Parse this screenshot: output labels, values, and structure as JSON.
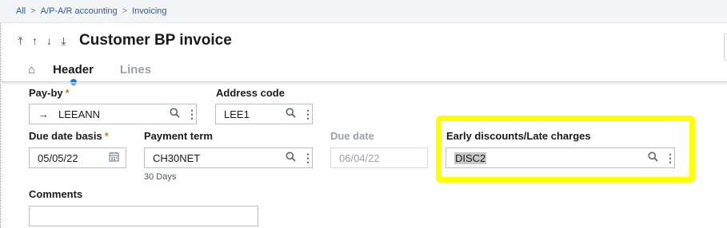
{
  "breadcrumb": {
    "items": [
      "All",
      "A/P-A/R accounting",
      "Invoicing"
    ],
    "separator": ">"
  },
  "title": "Customer BP invoice",
  "nav_icons": {
    "first": "⤒",
    "prev": "↑",
    "next": "↓",
    "last": "⤓"
  },
  "tabs": {
    "home_icon": "⌂",
    "header": "Header",
    "lines": "Lines"
  },
  "fields": {
    "pay_by": {
      "label": "Pay-by",
      "required": "*",
      "value": "LEEANN",
      "arrow": "→"
    },
    "address_code": {
      "label": "Address code",
      "value": "LEE1"
    },
    "due_date_basis": {
      "label": "Due date basis",
      "required": "*",
      "value": "05/05/22"
    },
    "payment_term": {
      "label": "Payment term",
      "value": "CH30NET",
      "note": "30 Days"
    },
    "due_date": {
      "label": "Due date",
      "value": "06/04/22"
    },
    "early_discounts": {
      "label": "Early discounts/Late charges",
      "value": "DISC2"
    },
    "comments": {
      "label": "Comments",
      "value": ""
    }
  },
  "colors": {
    "accent": "#1f78d1",
    "required": "#e2731d",
    "highlight": "#ffff00",
    "link": "#2c5aa0"
  }
}
